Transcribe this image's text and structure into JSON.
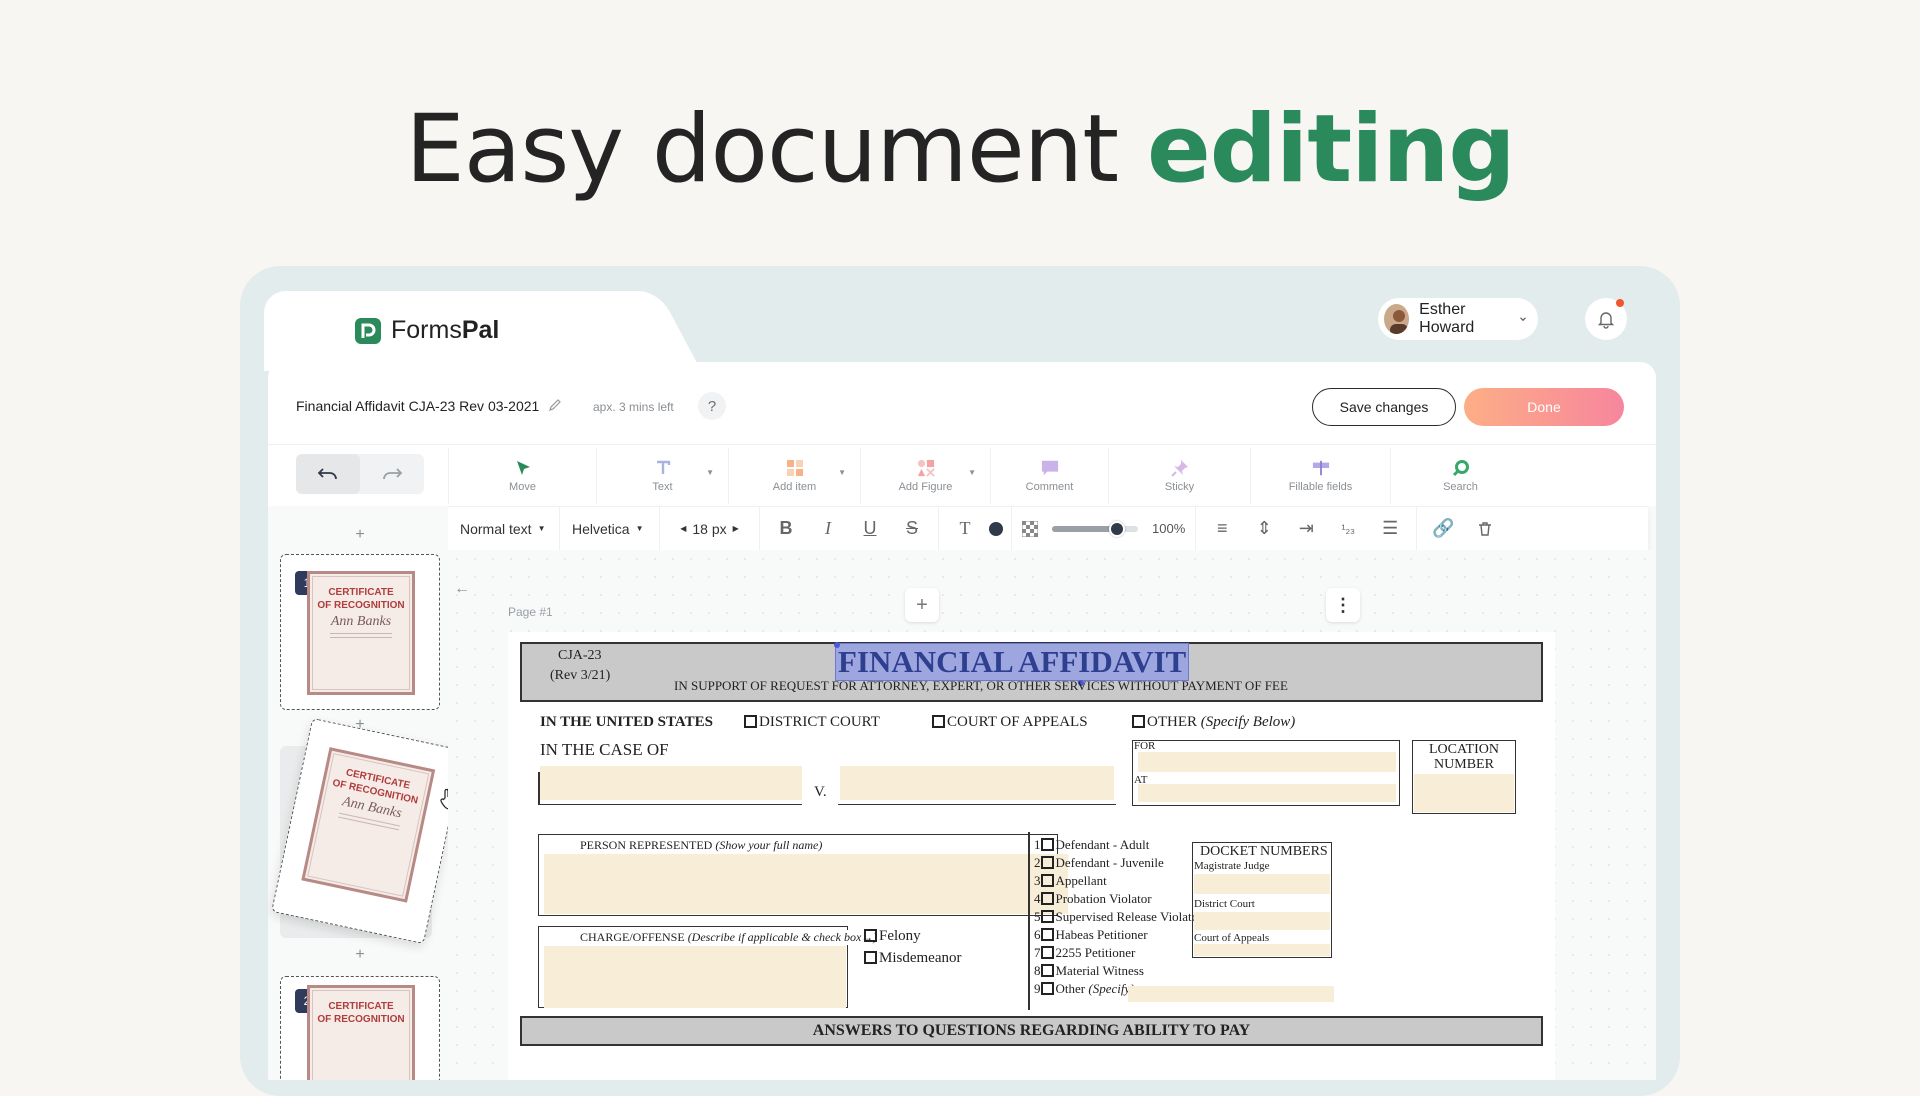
{
  "headline": {
    "prefix": "Easy document",
    "accent": "editing"
  },
  "brand": {
    "name_light": "Forms",
    "name_bold": "Pal"
  },
  "user": {
    "name": "Esther Howard"
  },
  "document": {
    "title": "Financial Affidavit CJA-23 Rev 03-2021",
    "time_left": "apx. 3 mins left",
    "help": "?"
  },
  "actions": {
    "save": "Save changes",
    "done": "Done"
  },
  "tools": [
    {
      "label": "Move",
      "icon": "cursor-icon",
      "color": "#2b8a5c"
    },
    {
      "label": "Text",
      "icon": "text-icon",
      "color": "#a8b4e0"
    },
    {
      "label": "Add item",
      "icon": "grid-icon",
      "color": "#f7b28a"
    },
    {
      "label": "Add Figure",
      "icon": "shapes-icon",
      "color": "#f2a4a4"
    },
    {
      "label": "Comment",
      "icon": "comment-icon",
      "color": "#c9b3e8"
    },
    {
      "label": "Sticky",
      "icon": "pin-icon",
      "color": "#d7b8e6"
    },
    {
      "label": "Fillable fields",
      "icon": "fields-icon",
      "color": "#b3a8e8"
    },
    {
      "label": "Search",
      "icon": "search-icon",
      "color": "#36a86b"
    }
  ],
  "format": {
    "style": "Normal text",
    "font": "Helvetica",
    "size": "18 px",
    "opacity": "100%",
    "opacity_value": 0.75
  },
  "pages": {
    "label": "Page #1",
    "thumbs": [
      {
        "num": "1"
      },
      {
        "num": "2"
      }
    ]
  },
  "certificate": {
    "title_line1": "CERTIFICATE",
    "title_line2": "OF RECOGNITION",
    "signature": "Ann Banks"
  },
  "form": {
    "code": "CJA-23",
    "rev": "(Rev 3/21)",
    "title": "FINANCIAL AFFIDAVIT",
    "subtitle": "IN SUPPORT OF REQUEST FOR ATTORNEY, EXPERT, OR OTHER SERVICES WITHOUT PAYMENT OF FEE",
    "in_us": "IN THE UNITED STATES",
    "district": "DISTRICT COURT",
    "appeals": "COURT OF APPEALS",
    "other": "OTHER",
    "other_note": "(Specify Below)",
    "case_of": "IN THE CASE OF",
    "vs": "V.",
    "for": "FOR",
    "at": "AT",
    "location": "LOCATION NUMBER",
    "person": "PERSON REPRESENTED",
    "person_note": "(Show your full name)",
    "charge": "CHARGE/OFFENSE",
    "charge_note": "(Describe if applicable & check box→)",
    "felony": "Felony",
    "misd": "Misdemeanor",
    "roles": [
      "Defendant - Adult",
      "Defendant - Juvenile",
      "Appellant",
      "Probation Violator",
      "Supervised Release Violator",
      "Habeas Petitioner",
      "2255 Petitioner",
      "Material Witness",
      "Other"
    ],
    "other_specify": "(Specify)",
    "docket": "DOCKET NUMBERS",
    "magistrate": "Magistrate Judge",
    "district_court": "District Court",
    "court_appeals": "Court of Appeals",
    "answers": "ANSWERS TO QUESTIONS REGARDING ABILITY TO PAY"
  }
}
